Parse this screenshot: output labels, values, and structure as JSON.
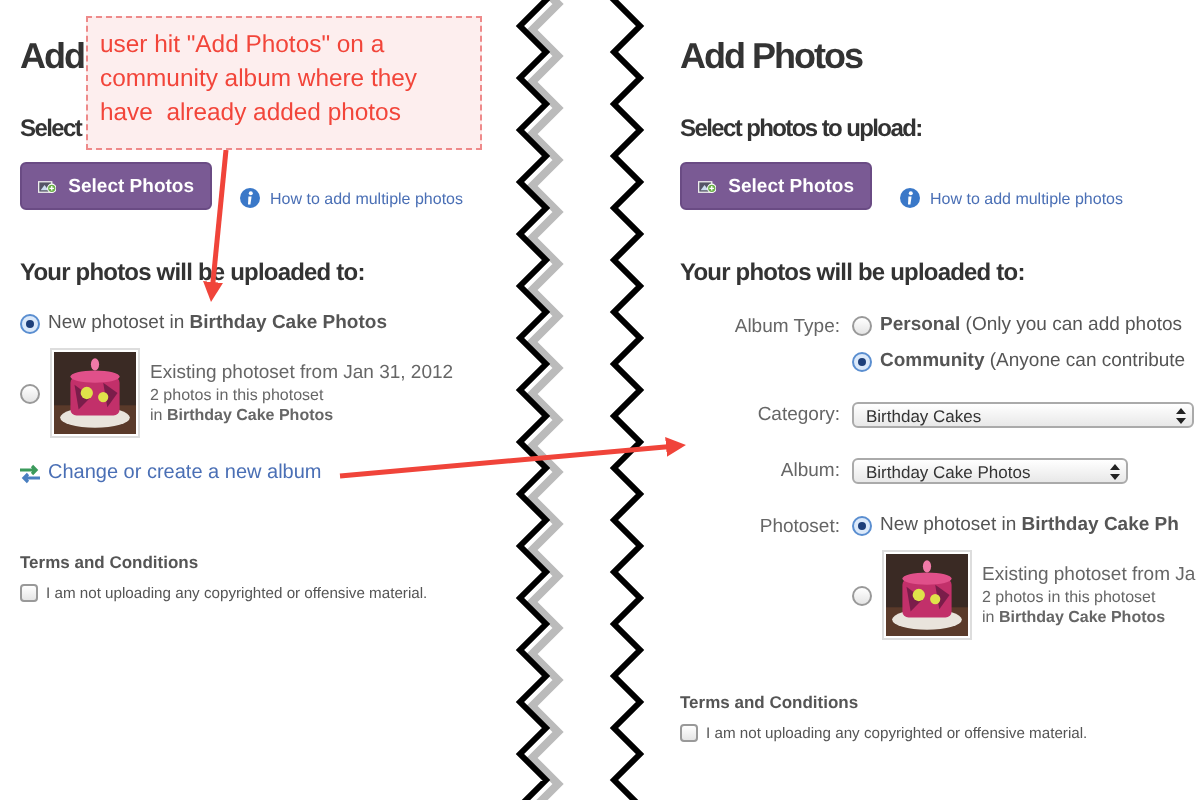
{
  "panels": [
    {
      "kind": "simple",
      "title": "Add",
      "select_heading": "Select",
      "select_button": "Select Photos",
      "help_link": "How to add multiple photos",
      "upload_heading": "Your photos will be uploaded to:",
      "photoset_options": [
        {
          "kind": "new",
          "text": "New photoset in **Birthday Cake Photos**",
          "selected": true
        },
        {
          "kind": "existing",
          "title": "Existing photoset from Jan 31, 2012",
          "count": "2 photos in this photoset",
          "album": "in **Birthday Cake Photos**",
          "selected": false
        }
      ],
      "change_link": "Change or create a new album",
      "terms": {
        "heading": "Terms and Conditions",
        "label": "I am not uploading any copyrighted or offensive material.",
        "checked": false
      }
    },
    {
      "kind": "detailed",
      "title": "Add Photos",
      "select_heading": "Select photos to upload:",
      "select_button": "Select Photos",
      "help_link": "How to add multiple photos",
      "upload_heading": "Your photos will be uploaded to:",
      "album_type": {
        "label": "Album Type:",
        "options": [
          {
            "name": "Personal",
            "note": "(Only you can add photos",
            "selected": false
          },
          {
            "name": "Community",
            "note": "(Anyone can contribute",
            "selected": true
          }
        ]
      },
      "category": {
        "label": "Category:",
        "value": "Birthday Cakes"
      },
      "album": {
        "label": "Album:",
        "value": "Birthday Cake Photos"
      },
      "photoset": {
        "label": "Photoset:",
        "options": [
          {
            "kind": "new",
            "text": "New photoset in **Birthday Cake Ph**",
            "selected": true
          },
          {
            "kind": "existing",
            "title": "Existing photoset from Ja",
            "count": "2 photos in this photoset",
            "album": "in **Birthday Cake Photos**",
            "selected": false
          }
        ]
      },
      "terms": {
        "heading": "Terms and Conditions",
        "label": "I am not uploading any copyrighted or offensive material.",
        "checked": false
      }
    }
  ],
  "callout": {
    "text": "user hit \"Add Photos\" on a community album where they have  already added photos"
  }
}
